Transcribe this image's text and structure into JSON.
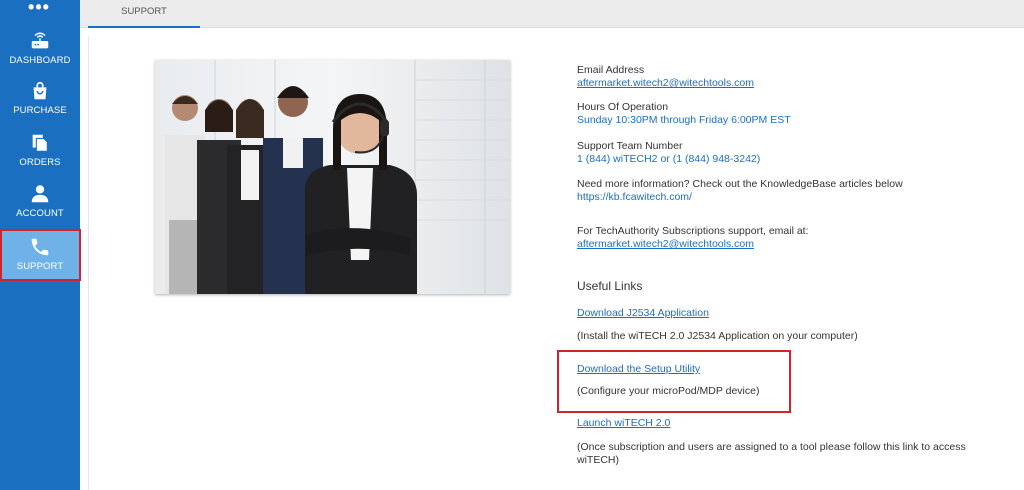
{
  "sidebar": {
    "more_icon": "more-dots-icon",
    "items": [
      {
        "label": "DASHBOARD",
        "icon": "router-icon"
      },
      {
        "label": "PURCHASE",
        "icon": "shopping-bag-icon"
      },
      {
        "label": "ORDERS",
        "icon": "documents-icon"
      },
      {
        "label": "ACCOUNT",
        "icon": "person-icon"
      },
      {
        "label": "SUPPORT",
        "icon": "phone-icon"
      }
    ],
    "active": "SUPPORT"
  },
  "topbar": {
    "tab_label": "SUPPORT"
  },
  "info": {
    "email_label": "Email Address",
    "email_value": "aftermarket.witech2@witechtools.com",
    "hours_label": "Hours Of Operation",
    "hours_value": "Sunday 10:30PM through Friday 6:00PM EST",
    "phone_label": "Support Team Number",
    "phone_value": "1 (844) wiTECH2 or (1 (844) 948-3242)",
    "kb_label": "Need more information? Check out the KnowledgeBase articles below",
    "kb_value": "https://kb.fcawitech.com/",
    "ta_label": "For TechAuthority Subscriptions support, email at:",
    "ta_value": "aftermarket.witech2@witechtools.com"
  },
  "useful_links": {
    "heading": "Useful Links",
    "links": [
      {
        "label": "Download J2534 Application",
        "desc": "(Install the wiTECH 2.0 J2534 Application on your computer)"
      },
      {
        "label": "Download the Setup Utility",
        "desc": "(Configure your microPod/MDP device)"
      },
      {
        "label": "Launch wiTECH 2.0",
        "desc": "(Once subscription and users are assigned to a tool please follow this link to access wiTECH)"
      }
    ]
  },
  "colors": {
    "sidebar": "#1b6fc0",
    "active_item": "#6fb2e8",
    "link": "#1b6fc0",
    "highlight": "#d2232a"
  }
}
